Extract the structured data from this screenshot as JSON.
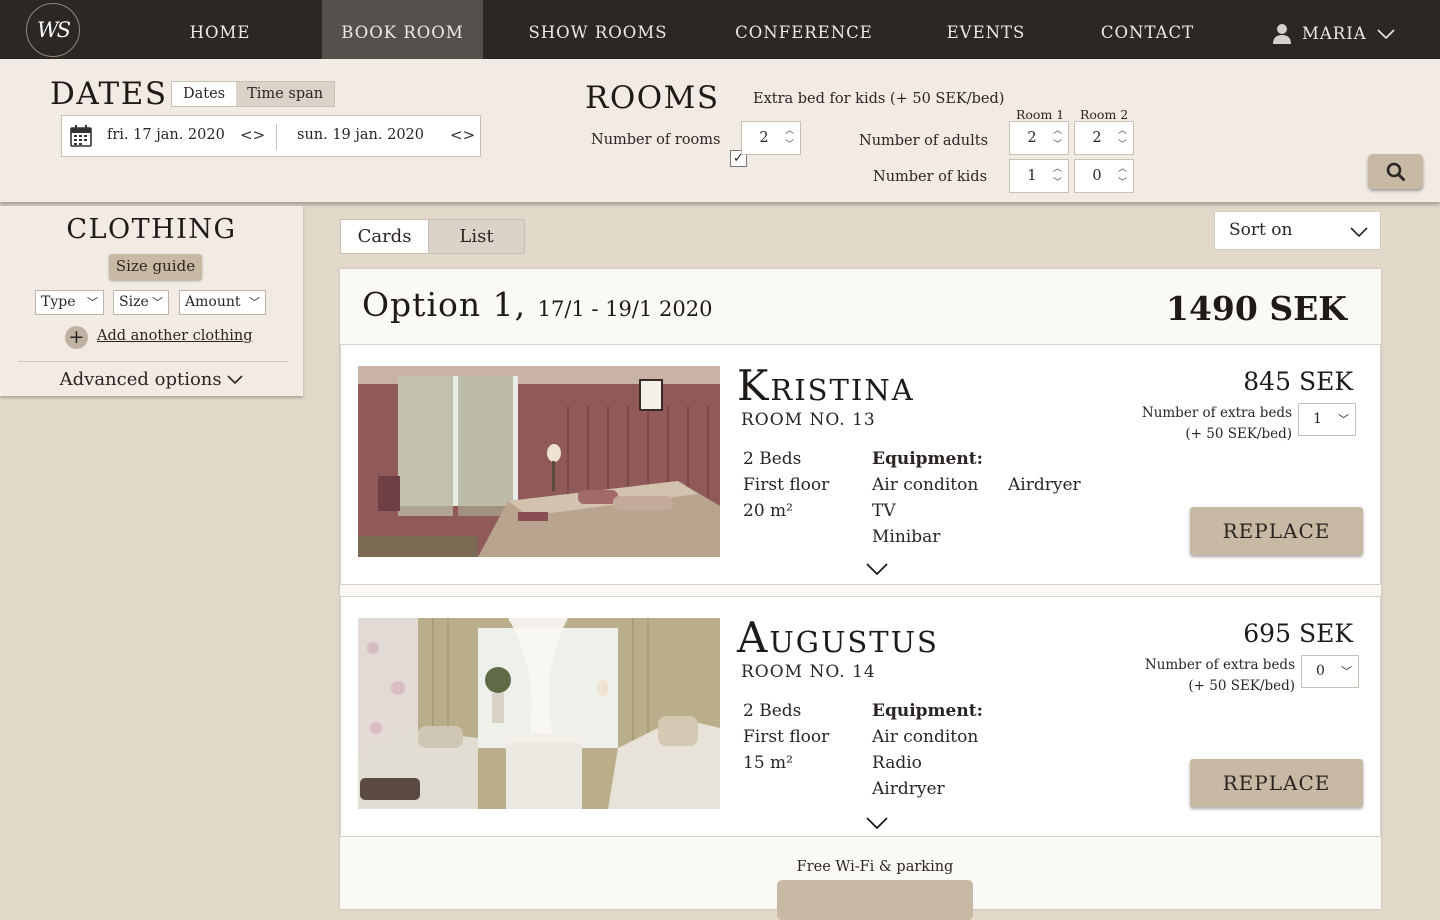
{
  "nav": {
    "logo_text": "WS",
    "items": [
      {
        "label": "HOME",
        "active": false
      },
      {
        "label": "BOOK ROOM",
        "active": true
      },
      {
        "label": "SHOW ROOMS",
        "active": false
      },
      {
        "label": "CONFERENCE",
        "active": false
      },
      {
        "label": "EVENTS",
        "active": false
      },
      {
        "label": "CONTACT",
        "active": false
      }
    ],
    "user": "MARIA",
    "user_icon": "user-icon"
  },
  "dates": {
    "title": "DATES",
    "toggle": [
      "Dates",
      "Time span"
    ],
    "from": "fri. 17 jan. 2020",
    "to": "sun. 19 jan. 2020"
  },
  "rooms": {
    "title": "ROOMS",
    "extra_bed_label": "Extra bed for kids (+ 50 SEK/bed)",
    "extra_bed_checked": true,
    "number_of_rooms_label": "Number of rooms",
    "number_of_rooms": "2",
    "room_headers": [
      "Room 1",
      "Room 2"
    ],
    "adults_label": "Number of adults",
    "adults": [
      "2",
      "2"
    ],
    "kids_label": "Number of kids",
    "kids": [
      "1",
      "0"
    ]
  },
  "sidebar": {
    "title": "CLOTHING",
    "size_guide": "Size guide",
    "filters": [
      "Type",
      "Size",
      "Amount"
    ],
    "add_label": "Add another clothing",
    "advanced": "Advanced options"
  },
  "view": {
    "tabs": [
      "Cards",
      "List"
    ],
    "sort_label": "Sort on"
  },
  "option": {
    "title": "Option 1,",
    "dates": "17/1 - 19/1 2020",
    "price": "1490 SEK",
    "rooms": [
      {
        "name": "Kristina",
        "number": "ROOM NO. 13",
        "price": "845 SEK",
        "facts": [
          "2 Beds",
          "First floor",
          "20 m²"
        ],
        "equipment_label": "Equipment:",
        "equipment": [
          "Air conditon",
          "TV",
          "Minibar"
        ],
        "equipment_extra": "Airdryer",
        "extra_beds_label": "Number of extra beds",
        "extra_beds_note": "(+ 50 SEK/bed)",
        "extra_beds": "1",
        "replace": "REPLACE"
      },
      {
        "name": "Augustus",
        "number": "ROOM NO. 14",
        "price": "695 SEK",
        "facts": [
          "2 Beds",
          "First floor",
          "15 m²"
        ],
        "equipment_label": "Equipment:",
        "equipment": [
          "Air conditon",
          "Radio",
          "Airdryer"
        ],
        "extra_beds_label": "Number of extra beds",
        "extra_beds_note": "(+ 50 SEK/bed)",
        "extra_beds": "0",
        "replace": "REPLACE"
      }
    ],
    "footer_note": "Free Wi-Fi & parking"
  }
}
